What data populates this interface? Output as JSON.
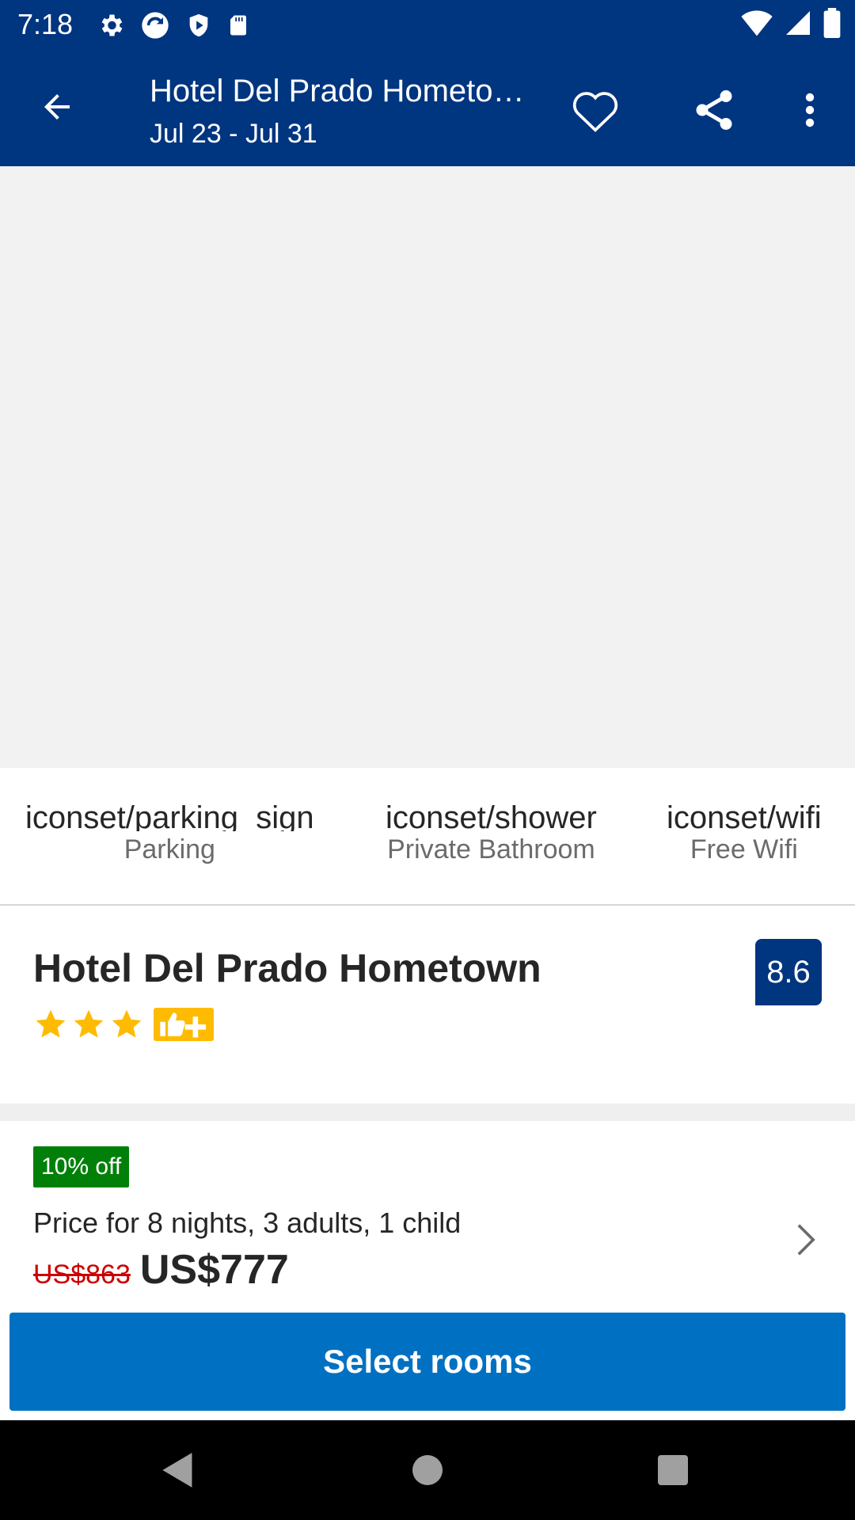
{
  "status_bar": {
    "time": "7:18",
    "left_icons": [
      "gear-icon",
      "sync-icon",
      "shield-icon",
      "sd-card-icon"
    ],
    "right_icons": [
      "wifi-icon",
      "signal-icon",
      "battery-icon"
    ]
  },
  "app_bar": {
    "title": "Hotel Del Prado Hometo…",
    "dates": "Jul 23 - Jul 31",
    "icons": [
      "back-arrow-icon",
      "heart-icon",
      "share-icon",
      "more-vert-icon"
    ]
  },
  "facilities": [
    {
      "icon_text": "iconset/parking_sign",
      "label": "Parking"
    },
    {
      "icon_text": "iconset/shower",
      "label": "Private Bathroom"
    },
    {
      "icon_text": "iconset/wifi",
      "label": "Free Wifi"
    }
  ],
  "hotel": {
    "name": "Hotel Del Prado Hometown",
    "star_count": 3,
    "score": "8.6"
  },
  "price": {
    "discount": "10% off",
    "description": "Price for 8 nights, 3 adults, 1 child",
    "old_price": "US$863",
    "new_price": "US$777"
  },
  "cta": {
    "select_rooms": "Select rooms"
  },
  "colors": {
    "brand_dark": "#003580",
    "primary_blue": "#0071c2",
    "discount_green": "#008009",
    "star_yellow": "#febb02",
    "old_price_red": "#cc0000"
  }
}
